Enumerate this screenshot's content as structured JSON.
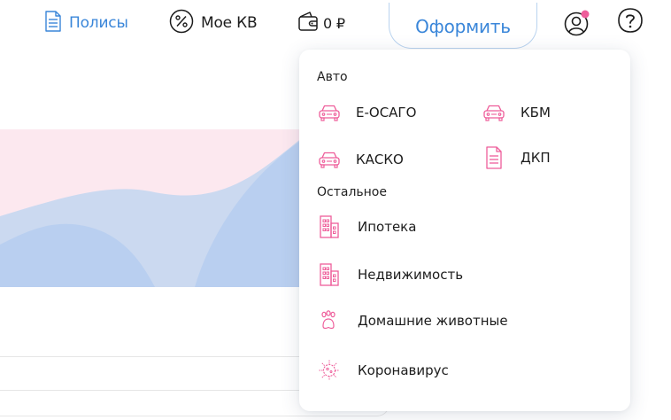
{
  "header": {
    "policies_label": "Полисы",
    "kv_label": "Мое КВ",
    "balance": "0 ₽",
    "issue_button": "Оформить"
  },
  "dropdown": {
    "groups": [
      {
        "title": "Авто",
        "items": [
          {
            "label": "Е-ОСАГО",
            "icon": "car-icon"
          },
          {
            "label": "КБМ",
            "icon": "car-icon"
          },
          {
            "label": "КАСКО",
            "icon": "car-icon"
          },
          {
            "label": "ДКП",
            "icon": "document-icon"
          }
        ]
      },
      {
        "title": "Остальное",
        "items": [
          {
            "label": "Ипотека",
            "icon": "building-icon"
          },
          {
            "label": "Недвижимость",
            "icon": "building-icon"
          },
          {
            "label": "Домашние животные",
            "icon": "paw-icon"
          },
          {
            "label": "Коронавирус",
            "icon": "virus-icon"
          }
        ]
      }
    ]
  },
  "colors": {
    "accent_blue": "#3a86d9",
    "accent_pink": "#ee5d9a",
    "banner_pink": "#fce8ef",
    "banner_blue": "#cbd9f0",
    "banner_blue_deep": "#b9cff0"
  }
}
